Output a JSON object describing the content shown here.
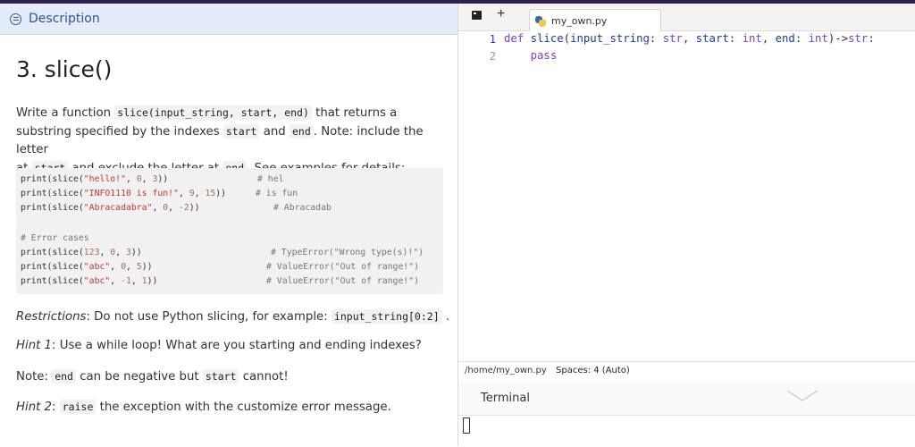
{
  "description": {
    "header_label": "Description",
    "title": "3. slice()",
    "intro": {
      "t1": "Write a function ",
      "c1": "slice(input_string, start, end)",
      "t2": " that returns a",
      "t3": "substring specified by the indexes ",
      "c2": "start",
      "t4": " and ",
      "c3": "end",
      "t5": ". Note: include the letter",
      "t6": "at ",
      "c4": "start",
      "t7": " and exclude the letter at ",
      "c5": "end",
      "t8": ". See examples for details:"
    },
    "code": {
      "l1": {
        "a": "print(slice(",
        "s": "\"hello!\"",
        "b": ", ",
        "n1": "0",
        "c": ", ",
        "n2": "3",
        "d": "))",
        "cm": "# hel"
      },
      "l2": {
        "a": "print(slice(",
        "s": "\"INFO1110 is fun!\"",
        "b": ", ",
        "n1": "9",
        "c": ", ",
        "n2": "15",
        "d": ")) ",
        "cm": "# is fun"
      },
      "l3": {
        "a": "print(slice(",
        "s": "\"Abracadabra\"",
        "b": ", ",
        "n1": "0",
        "c": ", ",
        "n2": "-2",
        "d": "))",
        "cm": "# Abracadab"
      },
      "l5": {
        "cm": "# Error cases"
      },
      "l6": {
        "a": "print(slice(",
        "n0": "123",
        "b": ", ",
        "n1": "0",
        "c": ", ",
        "n2": "3",
        "d": "))",
        "cm": "# TypeError(\"Wrong type(s)!\")"
      },
      "l7": {
        "a": "print(slice(",
        "s": "\"abc\"",
        "b": ", ",
        "n1": "0",
        "c": ", ",
        "n2": "5",
        "d": "))",
        "cm": "# ValueError(\"Out of range!\")"
      },
      "l8": {
        "a": "print(slice(",
        "s": "\"abc\"",
        "b": ", ",
        "n1": "-1",
        "c": ", ",
        "n2": "1",
        "d": "))",
        "cm": "# ValueError(\"Out of range!\")"
      }
    },
    "restrictions": {
      "em": "Restrictions",
      "t": ": Do not use Python slicing, for example: ",
      "c": "input_string[0:2]",
      "t2": " ."
    },
    "hint1": {
      "em": "Hint 1",
      "t": ": Use a while loop! What are you starting and ending indexes?"
    },
    "note": {
      "t": "Note: ",
      "c1": "end",
      "t2": " can be negative but ",
      "c2": "start",
      "t3": " cannot!"
    },
    "hint2": {
      "em": "Hint 2",
      "t": ": ",
      "c": "raise",
      "t2": " the exception with the customize error message."
    }
  },
  "editor": {
    "new_tab_symbol": "+",
    "tab_label": "my_own.py",
    "line_numbers": [
      "1",
      "2"
    ],
    "line1": {
      "def": "def ",
      "fn": "slice",
      "p1": "(",
      "a1": "input_string",
      "c1": ": ",
      "t1": "str",
      "s1": ", ",
      "a2": "start",
      "c2": ": ",
      "t2": "int",
      "s2": ", ",
      "a3": "end",
      "c3": ": ",
      "t3": "int",
      "e": ")->",
      "rt": "str",
      "end": ":"
    },
    "line2": {
      "indent": "    ",
      "kw": "pass"
    }
  },
  "status": {
    "path": "/home/my_own.py",
    "spaces": "Spaces: 4 (Auto)"
  },
  "terminal": {
    "tab_label": "Terminal"
  },
  "colors": {
    "accent": "#2f6fe0",
    "header_bg": "#e4ecf9",
    "keyword": "#7b3fc9"
  }
}
